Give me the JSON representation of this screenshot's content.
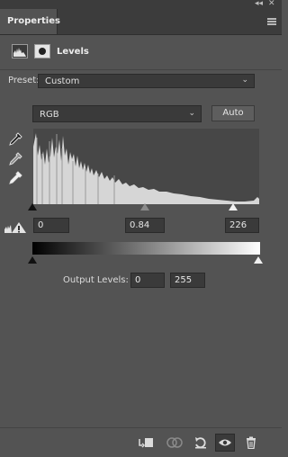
{
  "window": {
    "collapse_glyph": "◂◂",
    "close_glyph": "✕"
  },
  "tab": {
    "title": "Properties"
  },
  "panel": {
    "adjustment_title": "Levels"
  },
  "preset": {
    "label": "Preset:",
    "value": "Custom"
  },
  "channel": {
    "value": "RGB",
    "auto_label": "Auto"
  },
  "input_levels": {
    "black": "0",
    "gamma": "0.84",
    "white": "226"
  },
  "output_levels": {
    "label": "Output Levels:",
    "black": "0",
    "white": "255"
  },
  "icons": [
    "panel-menu-icon",
    "histogram-adjustment-icon",
    "layer-mask-icon",
    "black-eyedropper-icon",
    "gray-eyedropper-icon",
    "white-eyedropper-icon",
    "clipping-warning-icon",
    "clip-to-layer-icon",
    "view-previous-state-icon",
    "reset-icon",
    "visibility-eye-icon",
    "delete-trash-icon"
  ],
  "colors": {
    "panel_bg": "#535353",
    "field_bg": "#3a3a3a",
    "histogram_bg": "#474747",
    "histogram_fill": "#d6d6d6"
  }
}
